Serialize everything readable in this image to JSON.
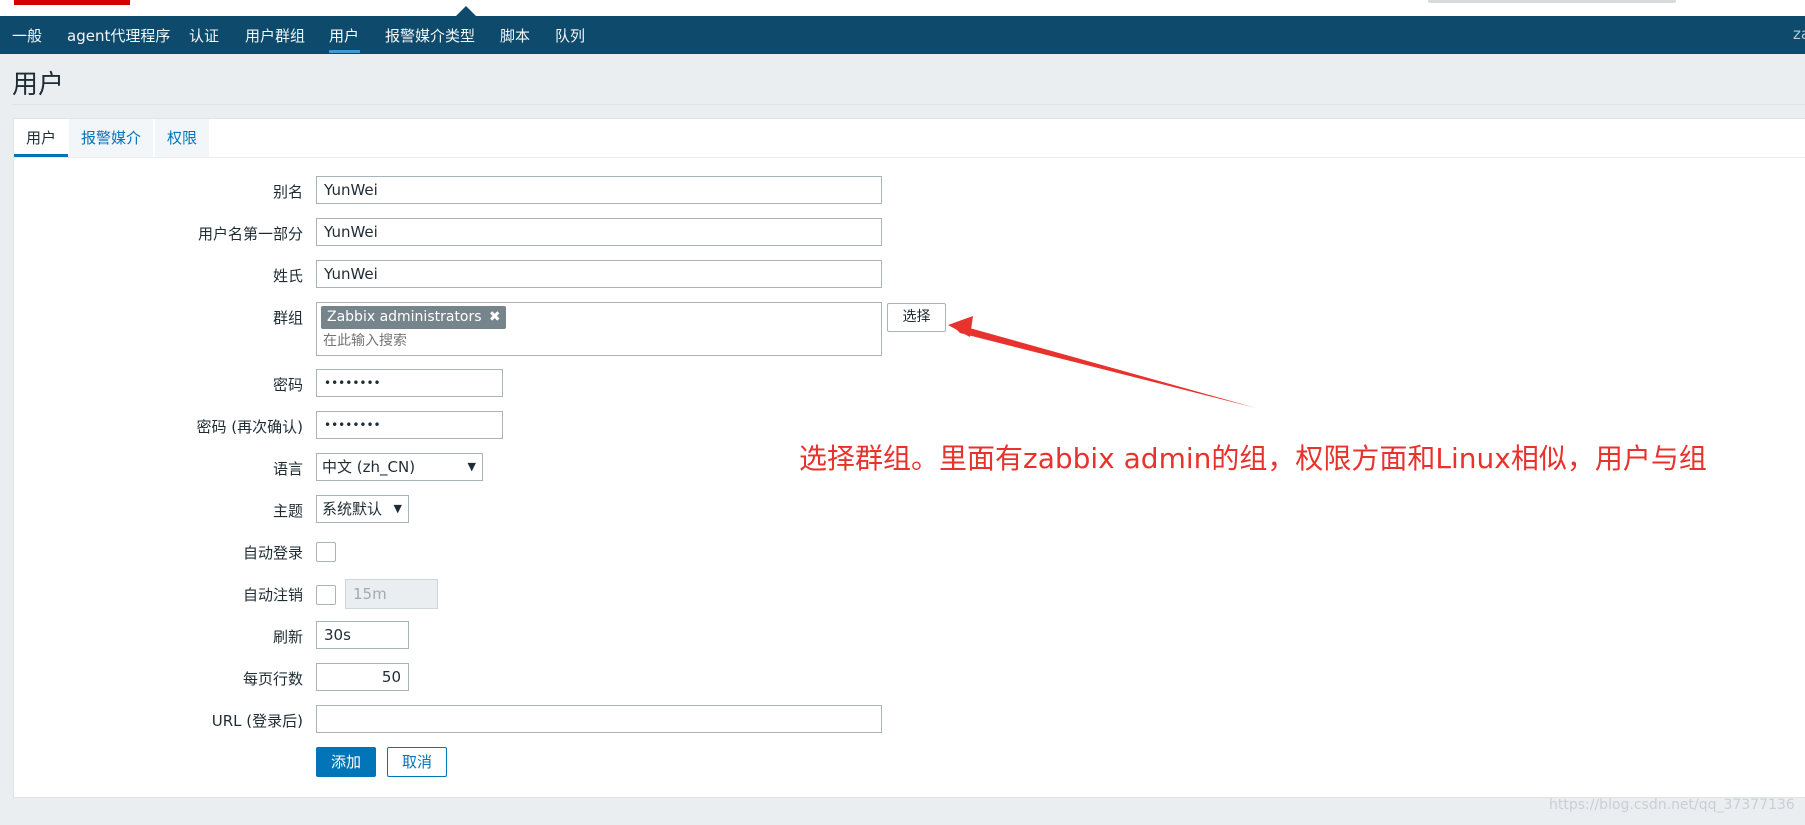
{
  "topnav": {
    "items": [
      "一般",
      "agent代理程序",
      "认证",
      "用户群组",
      "用户",
      "报警媒介类型",
      "脚本",
      "队列"
    ],
    "active_index": 4,
    "user_partial": "za"
  },
  "page": {
    "title": "用户"
  },
  "tabs": [
    {
      "label": "用户",
      "active": true
    },
    {
      "label": "报警媒介",
      "active": false
    },
    {
      "label": "权限",
      "active": false
    }
  ],
  "form": {
    "alias": {
      "label": "别名",
      "value": "YunWei"
    },
    "first_name": {
      "label": "用户名第一部分",
      "value": "YunWei"
    },
    "last_name": {
      "label": "姓氏",
      "value": "YunWei"
    },
    "groups": {
      "label": "群组",
      "chip": "Zabbix administrators",
      "placeholder": "在此输入搜索",
      "select_button": "选择"
    },
    "password": {
      "label": "密码",
      "value": "••••••••"
    },
    "password_confirm": {
      "label": "密码 (再次确认)",
      "value": "••••••••"
    },
    "language": {
      "label": "语言",
      "value": "中文 (zh_CN)"
    },
    "theme": {
      "label": "主题",
      "value": "系统默认"
    },
    "autologin": {
      "label": "自动登录",
      "checked": false
    },
    "autologout": {
      "label": "自动注销",
      "checked": false,
      "value": "15m"
    },
    "refresh": {
      "label": "刷新",
      "value": "30s"
    },
    "rows_per_page": {
      "label": "每页行数",
      "value": "50"
    },
    "url": {
      "label": "URL (登录后)",
      "value": ""
    },
    "add_button": "添加",
    "cancel_button": "取消"
  },
  "annotation": {
    "text": "选择群组。里面有zabbix admin的组，权限方面和Linux相似，用户与组",
    "color": "#e8322d"
  },
  "watermark": "https://blog.csdn.net/qq_37377136",
  "colors": {
    "navbar": "#0e4a6c",
    "accent": "#0275b8",
    "chip": "#76848c"
  }
}
